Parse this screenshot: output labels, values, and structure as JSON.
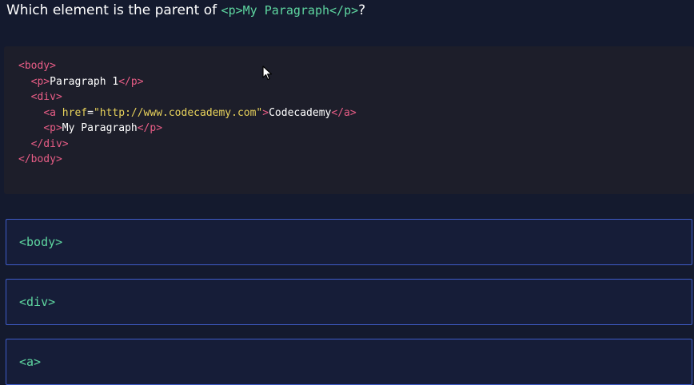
{
  "question": {
    "prefix": "Which element is the parent of ",
    "code": "<p>My Paragraph</p>",
    "suffix": "?"
  },
  "code_block": {
    "lines": [
      [
        {
          "t": "tag",
          "v": "<body>"
        }
      ],
      [
        {
          "t": "txt",
          "v": "  "
        },
        {
          "t": "tag",
          "v": "<p>"
        },
        {
          "t": "txt",
          "v": "Paragraph 1"
        },
        {
          "t": "tag",
          "v": "</p>"
        }
      ],
      [
        {
          "t": "txt",
          "v": "  "
        },
        {
          "t": "tag",
          "v": "<div>"
        }
      ],
      [
        {
          "t": "txt",
          "v": "    "
        },
        {
          "t": "tag",
          "v": "<a "
        },
        {
          "t": "attr",
          "v": "href"
        },
        {
          "t": "txt",
          "v": "="
        },
        {
          "t": "str",
          "v": "\"http://www.codecademy.com\""
        },
        {
          "t": "tag",
          "v": ">"
        },
        {
          "t": "txt",
          "v": "Codecademy"
        },
        {
          "t": "tag",
          "v": "</a>"
        }
      ],
      [
        {
          "t": "txt",
          "v": "    "
        },
        {
          "t": "tag",
          "v": "<p>"
        },
        {
          "t": "txt",
          "v": "My Paragraph"
        },
        {
          "t": "tag",
          "v": "</p>"
        }
      ],
      [
        {
          "t": "txt",
          "v": "  "
        },
        {
          "t": "tag",
          "v": "</div>"
        }
      ],
      [
        {
          "t": "tag",
          "v": "</body>"
        }
      ]
    ]
  },
  "options": [
    {
      "label": "<body>"
    },
    {
      "label": "<div>"
    },
    {
      "label": "<a>"
    }
  ],
  "colors": {
    "background": "#141a2e",
    "code_background": "#1d1e2a",
    "tag": "#e85d86",
    "attribute": "#e8d25b",
    "option_border": "#3f5cc8",
    "option_text": "#5ed6a0"
  }
}
